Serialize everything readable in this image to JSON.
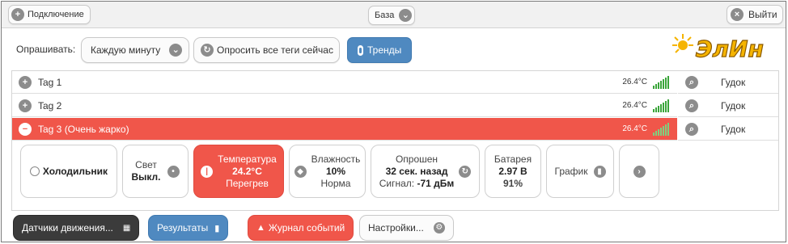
{
  "topbar": {
    "connect_label": "Подключение",
    "base_label": "База",
    "logout_label": "Выйти"
  },
  "poll": {
    "label": "Опрашивать:",
    "interval": "Каждую минуту",
    "poll_all_label": "Опросить все теги сейчас",
    "trends_label": "Тренды"
  },
  "logo": {
    "text": "ЭлИн",
    "color": "#f5b400"
  },
  "tags": [
    {
      "name": "Tag 1",
      "value": "26.4°C",
      "expand": "+",
      "alarm": false
    },
    {
      "name": "Tag 2",
      "value": "26.4°C",
      "expand": "+",
      "alarm": false
    },
    {
      "name": "Tag 3 (Очень жарко)",
      "value": "26.4°C",
      "expand": "−",
      "alarm": true
    }
  ],
  "side": {
    "beep_label": "Гудок"
  },
  "cards": {
    "fridge": "Холодильник",
    "light_title": "Свет",
    "light_state": "Выкл.",
    "temp_title": "Температура",
    "temp_value": "24.2°C",
    "temp_status": "Перегрев",
    "humidity_title": "Влажность",
    "humidity_value": "10%",
    "humidity_status": "Норма",
    "polled_title": "Опрошен",
    "polled_value": "32 сек. назад",
    "signal_label": "Сигнал:",
    "signal_value": "-71 дБм",
    "battery_title": "Батарея",
    "battery_value": "2.97 В",
    "battery_percent": "91%",
    "graph_label": "График"
  },
  "bottom": {
    "motion_label": "Датчики движения...",
    "results_label": "Результаты",
    "journal_label": "Журнал событий",
    "settings_label": "Настройки..."
  },
  "colors": {
    "accent_blue": "#4f89c0",
    "alarm_red": "#f0564a",
    "signal_green": "#3aa53a",
    "dark": "#3b3b3b"
  },
  "icons": [
    "plus-circle-icon",
    "chevron-down-icon",
    "close-circle-icon",
    "thermometer-icon",
    "signal-bars-icon",
    "search-icon",
    "water-drop-icon",
    "battery-icon",
    "chart-icon",
    "chevron-right-icon",
    "grid-icon",
    "warning-icon",
    "gear-icon"
  ]
}
